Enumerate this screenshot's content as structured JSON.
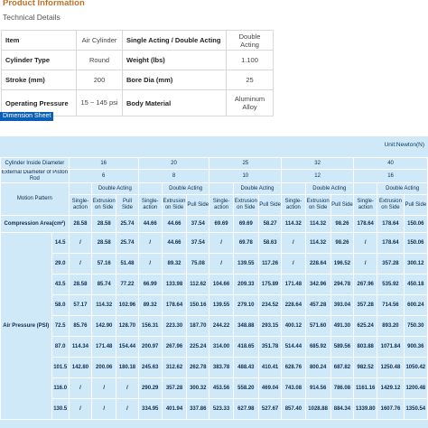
{
  "product_info": {
    "title": "Product Information",
    "subtitle": "Technical Details"
  },
  "specs": [
    {
      "k1": "Item",
      "v1": "Air Cylinder",
      "k2": "Single Acting / Double Acting",
      "v2": "Double Acting"
    },
    {
      "k1": "Cylinder Type",
      "v1": "Round",
      "k2": "Weight (lbs)",
      "v2": "1.100"
    },
    {
      "k1": "Stroke (mm)",
      "v1": "200",
      "k2": "Bore Dia (mm)",
      "v2": "25"
    },
    {
      "k1": "Operating Pressure",
      "v1": "15 ~ 145 psi",
      "k2": "Body Material",
      "v2": "Aluminum Alloy"
    }
  ],
  "dimension_tab": "Dimension Sheet",
  "dimension_sheet": {
    "unit": "Unit:Newton(N)",
    "labels": {
      "bore": "Cylinder Inside Diameter",
      "rod": "External Diameter of Piston Rod",
      "motion": "Motion Pattern",
      "area": "Compression Area(cm²)",
      "pressure": "Air Pressure (PSI)",
      "double_acting": "Double Acting",
      "single_action": "Single-action",
      "extrusion": "Extrusion on Side",
      "pull": "Pull Side"
    },
    "bores": [
      "16",
      "20",
      "25",
      "32",
      "40"
    ],
    "rods": [
      "6",
      "8",
      "10",
      "12",
      "16"
    ],
    "area_row": [
      "28.58",
      "28.58",
      "25.74",
      "44.66",
      "44.66",
      "37.54",
      "69.69",
      "69.69",
      "58.27",
      "114.32",
      "114.32",
      "98.26",
      "178.64",
      "178.64",
      "150.06"
    ],
    "pressure_rows": [
      {
        "psi": "14.5",
        "vals": [
          "/",
          "28.58",
          "25.74",
          "/",
          "44.66",
          "37.54",
          "/",
          "69.78",
          "58.63",
          "/",
          "114.32",
          "98.26",
          "/",
          "178.64",
          "150.06"
        ]
      },
      {
        "psi": "29.0",
        "vals": [
          "/",
          "57.16",
          "51.48",
          "/",
          "89.32",
          "75.08",
          "/",
          "139.55",
          "117.26",
          "/",
          "228.64",
          "196.52",
          "/",
          "357.28",
          "300.12"
        ]
      },
      {
        "psi": "43.5",
        "vals": [
          "28.58",
          "85.74",
          "77.22",
          "66.99",
          "133.98",
          "112.62",
          "104.66",
          "209.33",
          "175.89",
          "171.48",
          "342.96",
          "294.78",
          "267.96",
          "535.92",
          "450.18"
        ]
      },
      {
        "psi": "58.0",
        "vals": [
          "57.17",
          "114.32",
          "102.96",
          "89.32",
          "178.64",
          "150.16",
          "139.55",
          "279.10",
          "234.52",
          "228.64",
          "457.28",
          "393.04",
          "357.28",
          "714.56",
          "600.24"
        ]
      },
      {
        "psi": "72.5",
        "vals": [
          "85.76",
          "142.90",
          "128.70",
          "156.31",
          "223.30",
          "187.70",
          "244.22",
          "348.88",
          "293.15",
          "400.12",
          "571.60",
          "491.30",
          "625.24",
          "893.20",
          "750.30"
        ]
      },
      {
        "psi": "87.0",
        "vals": [
          "114.34",
          "171.48",
          "154.44",
          "200.97",
          "267.96",
          "225.24",
          "314.00",
          "418.65",
          "351.78",
          "514.44",
          "685.92",
          "589.56",
          "803.88",
          "1071.84",
          "900.36"
        ]
      },
      {
        "psi": "101.5",
        "vals": [
          "142.80",
          "200.06",
          "180.18",
          "245.63",
          "312.62",
          "262.78",
          "383.78",
          "488.43",
          "410.41",
          "628.76",
          "800.24",
          "687.82",
          "982.52",
          "1250.48",
          "1050.42"
        ]
      },
      {
        "psi": "116.0",
        "vals": [
          "/",
          "/",
          "/",
          "290.29",
          "357.28",
          "300.32",
          "453.56",
          "558.20",
          "469.04",
          "743.08",
          "914.56",
          "786.08",
          "1161.16",
          "1429.12",
          "1200.48"
        ]
      },
      {
        "psi": "130.5",
        "vals": [
          "/",
          "/",
          "/",
          "334.95",
          "401.94",
          "337.86",
          "523.33",
          "627.98",
          "527.67",
          "857.40",
          "1028.88",
          "884.34",
          "1339.80",
          "1607.76",
          "1350.54"
        ]
      }
    ]
  }
}
